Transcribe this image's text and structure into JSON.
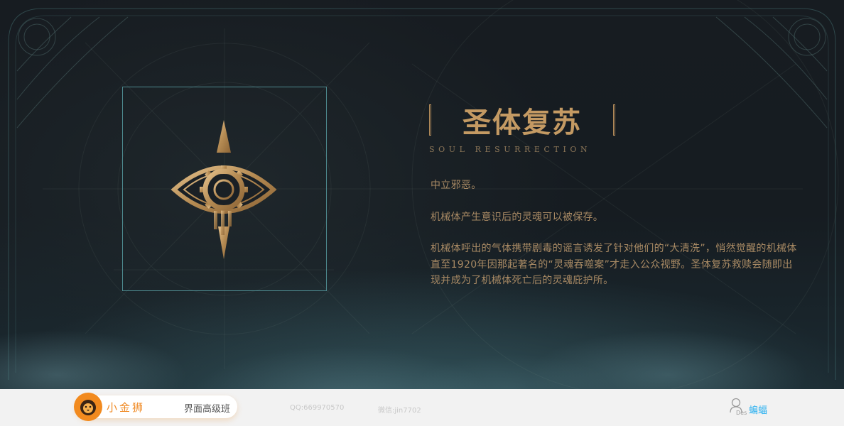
{
  "hero": {
    "title": "圣体复苏",
    "subtitle": "SOUL RESURRECTION",
    "paragraphs": [
      "中立邪恶。",
      "机械体产生意识后的灵魂可以被保存。",
      "机械体呼出的气体携带剧毒的谣言诱发了针对他们的“大清洗”，悄然觉醒的机械体直至1920年因那起著名的“灵魂吞噬案”才走入公众视野。圣体复苏救赎会随即出现并成为了机械体死亡后的灵魂庇护所。"
    ],
    "emblem_icon": "eye-gear-emblem-icon"
  },
  "colors": {
    "gold": "#c49a63",
    "frame_teal": "#4e8a8f",
    "brand_orange": "#f08a24",
    "author_blue": "#29b0f0"
  },
  "footer": {
    "brand": "小金狮",
    "course": "界面高级班",
    "qq": "QQ:669970570",
    "wechat": "微信:jin7702",
    "author_tag": "Des",
    "author": "蝙蝠",
    "logo_icon": "lion-logo-icon",
    "author_icon": "person-outline-icon"
  }
}
